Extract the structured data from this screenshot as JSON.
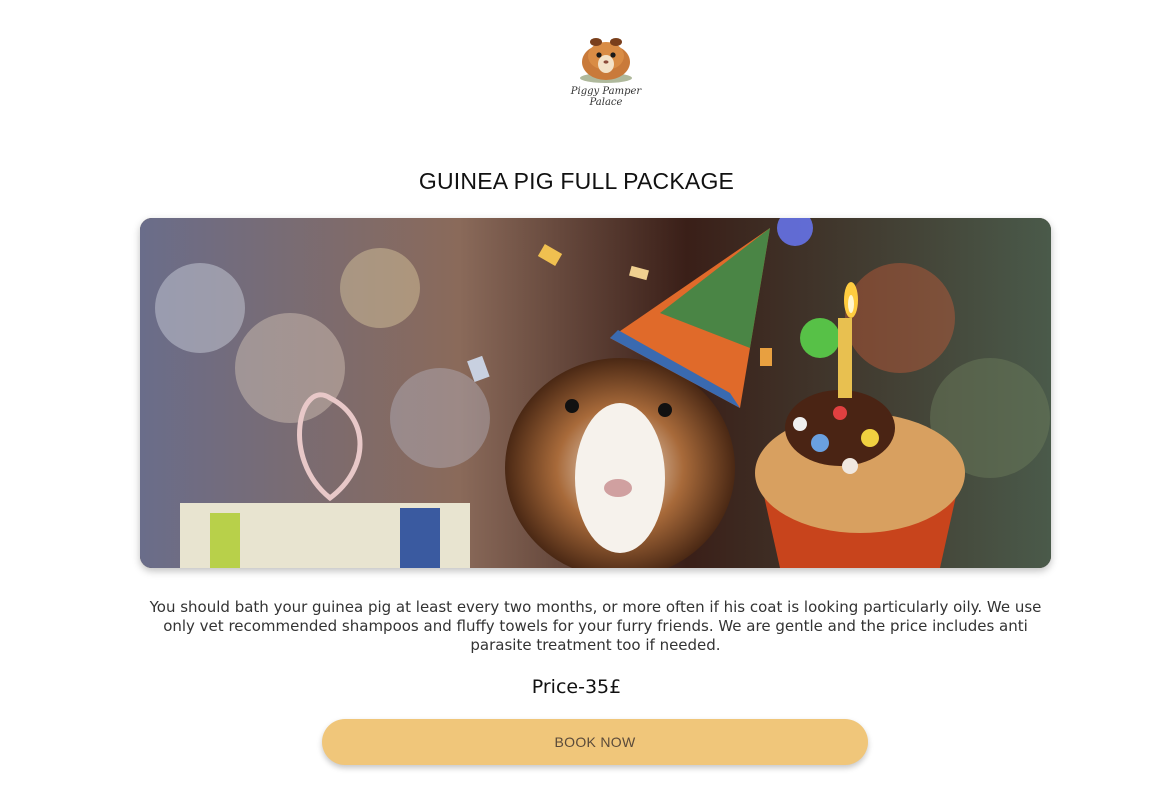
{
  "brand": {
    "name_line1": "Piggy Pamper",
    "name_line2": "Palace",
    "logo_icon": "guinea-pig-icon"
  },
  "service": {
    "title": "GUINEA PIG FULL PACKAGE",
    "description": "You should bath your guinea pig at least every two months, or more often if his coat is looking particularly oily. We use only vet recommended shampoos and fluffy towels for your furry friends. We are gentle and the price includes anti parasite treatment too if needed.",
    "price": "Price-35£",
    "book_label": "BOOK NOW"
  },
  "colors": {
    "button_bg": "#f0c67a",
    "text": "#333333"
  }
}
